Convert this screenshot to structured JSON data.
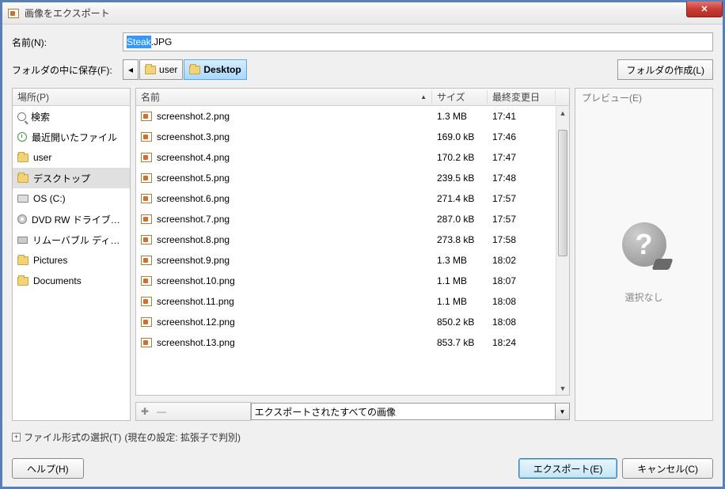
{
  "titlebar": {
    "title": "画像をエクスポート"
  },
  "name_row": {
    "label": "名前(N):",
    "selected_part": "Steak",
    "rest_part": ".JPG"
  },
  "path_row": {
    "label": "フォルダの中に保存(F):",
    "back_arrow": "◂",
    "crumbs": [
      {
        "label": "user",
        "active": false
      },
      {
        "label": "Desktop",
        "active": true
      }
    ],
    "create_folder": "フォルダの作成(L)"
  },
  "places": {
    "header": "場所(P)",
    "items": [
      {
        "icon": "search",
        "label": "検索"
      },
      {
        "icon": "clock",
        "label": "最近開いたファイル"
      },
      {
        "icon": "folder",
        "label": "user"
      },
      {
        "icon": "folder",
        "label": "デスクトップ",
        "selected": true
      },
      {
        "icon": "drive",
        "label": "OS (C:)"
      },
      {
        "icon": "disc",
        "label": "DVD RW ドライブ…"
      },
      {
        "icon": "usb",
        "label": "リムーバブル ディ…"
      },
      {
        "icon": "folder",
        "label": "Pictures"
      },
      {
        "icon": "folder",
        "label": "Documents"
      }
    ],
    "add_glyph": "✚",
    "remove_glyph": "—"
  },
  "filelist": {
    "headers": {
      "name": "名前",
      "size": "サイズ",
      "date": "最終変更日"
    },
    "sort_indicator": "▲",
    "rows": [
      {
        "name": "screenshot.2.png",
        "size": "1.3 MB",
        "date": "17:41"
      },
      {
        "name": "screenshot.3.png",
        "size": "169.0 kB",
        "date": "17:46"
      },
      {
        "name": "screenshot.4.png",
        "size": "170.2 kB",
        "date": "17:47"
      },
      {
        "name": "screenshot.5.png",
        "size": "239.5 kB",
        "date": "17:48"
      },
      {
        "name": "screenshot.6.png",
        "size": "271.4 kB",
        "date": "17:57"
      },
      {
        "name": "screenshot.7.png",
        "size": "287.0 kB",
        "date": "17:57"
      },
      {
        "name": "screenshot.8.png",
        "size": "273.8 kB",
        "date": "17:58"
      },
      {
        "name": "screenshot.9.png",
        "size": "1.3 MB",
        "date": "18:02"
      },
      {
        "name": "screenshot.10.png",
        "size": "1.1 MB",
        "date": "18:07"
      },
      {
        "name": "screenshot.11.png",
        "size": "1.1 MB",
        "date": "18:08"
      },
      {
        "name": "screenshot.12.png",
        "size": "850.2 kB",
        "date": "18:08"
      },
      {
        "name": "screenshot.13.png",
        "size": "853.7 kB",
        "date": "18:24"
      }
    ]
  },
  "preview": {
    "header": "プレビュー(E)",
    "empty_text": "選択なし"
  },
  "filter": {
    "selected": "エクスポートされたすべての画像"
  },
  "fileformat": {
    "expander": "+",
    "label": "ファイル形式の選択(T)",
    "current": "(現在の設定: 拡張子で判別)"
  },
  "buttons": {
    "help": "ヘルプ(H)",
    "export": "エクスポート(E)",
    "cancel": "キャンセル(C)"
  }
}
